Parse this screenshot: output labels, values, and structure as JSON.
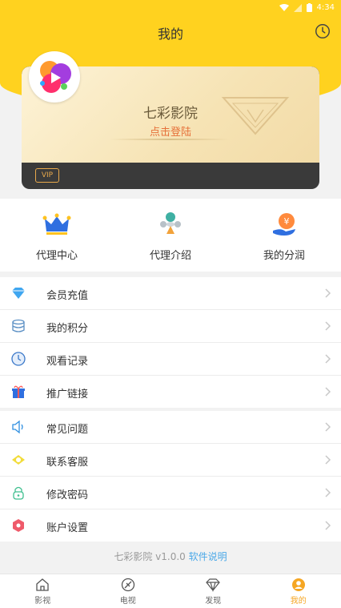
{
  "status": {
    "time": "4:34"
  },
  "header": {
    "title": "我的"
  },
  "card": {
    "brand": "七彩影院",
    "login": "点击登陆",
    "vip": "VIP"
  },
  "quick": [
    {
      "label": "代理中心",
      "icon": "crown-icon"
    },
    {
      "label": "代理介绍",
      "icon": "hourglass-icon"
    },
    {
      "label": "我的分润",
      "icon": "yuan-hand-icon"
    }
  ],
  "menu1": [
    {
      "label": "会员充值",
      "icon": "diamond-icon"
    },
    {
      "label": "我的积分",
      "icon": "coins-icon"
    },
    {
      "label": "观看记录",
      "icon": "clock-icon"
    },
    {
      "label": "推广链接",
      "icon": "gift-icon"
    }
  ],
  "menu2": [
    {
      "label": "常见问题",
      "icon": "speaker-icon"
    },
    {
      "label": "联系客服",
      "icon": "eye-icon"
    },
    {
      "label": "修改密码",
      "icon": "lock-icon"
    },
    {
      "label": "账户设置",
      "icon": "hexagon-icon"
    }
  ],
  "footer": {
    "version": "七彩影院 v1.0.0 ",
    "link": "软件说明"
  },
  "tabs": [
    {
      "label": "影视",
      "icon": "home-icon"
    },
    {
      "label": "电视",
      "icon": "tv-icon"
    },
    {
      "label": "发现",
      "icon": "diamond-outline-icon"
    },
    {
      "label": "我的",
      "icon": "user-icon"
    }
  ],
  "colors": {
    "brand_yellow": "#ffd21f",
    "accent_orange": "#e6713a",
    "link_blue": "#4aa8e8",
    "active_tab": "#f5a623"
  }
}
